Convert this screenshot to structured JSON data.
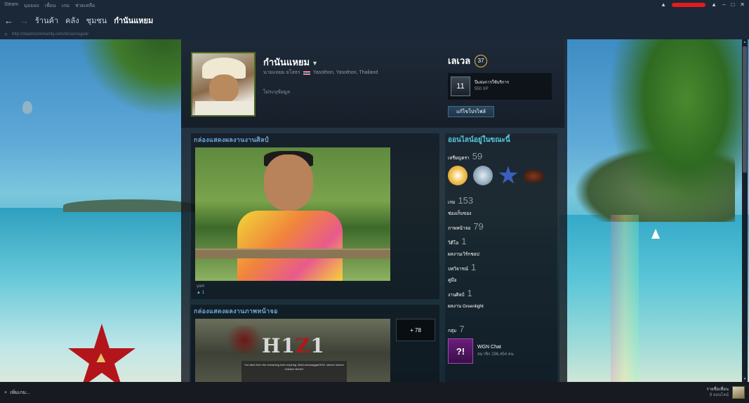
{
  "topmenu": [
    "Steam",
    "มุมมอง",
    "เพื่อน",
    "เกม",
    "ช่วยเหลือ"
  ],
  "nav": {
    "back": "←",
    "forward": "→",
    "tabs": [
      "ร้านค้า",
      "คลัง",
      "ชุมชน",
      "กำนันแหยม"
    ],
    "active_tab": "กำนันแหยม"
  },
  "url": "http://steamcommunity.com/id/sunnogod/",
  "profile": {
    "name": "กำนันแหยม",
    "real_name": "นายแหยม ยโสธร",
    "location": "Yasothon, Yasothon, Thailand",
    "summary": "ไม่ระบุข้อมูล",
    "level_label": "เลเวล",
    "level": "37",
    "badge_title": "ปีแห่งการใช้บริการ",
    "badge_xp": "550 XP",
    "badge_icon_text": "11",
    "edit_button": "แก้ไขโปรไฟล์"
  },
  "showcases": {
    "artwork_title": "กล่องแสดงผลงานงานศิลป์",
    "artwork_caption": "yam",
    "artwork_likes": "1",
    "screenshot_title": "กล่องแสดงผลงานภาพหน้าจอ",
    "screenshot_more": "+ 78",
    "screenshot_logo_a": "H1",
    "screenshot_logo_z": "Z",
    "screenshot_logo_b": "1",
    "screenshot_dialog": "You died from the remaining lives expiring. BobLee/swaggerHHH, winner winner chicken dinner!"
  },
  "sidebar": {
    "online_status": "ออนไลน์อยู่ในขณะนี้",
    "badges_label": "เหรียญตรา",
    "badges_count": "59",
    "games_label": "เกม",
    "games_count": "153",
    "inventory_label": "ช่องเก็บของ",
    "screenshots_label": "ภาพหน้าจอ",
    "screenshots_count": "79",
    "videos_label": "วิดีโอ",
    "videos_count": "1",
    "workshop_label": "ผลงานเวิร์กชอป",
    "reviews_label": "บทวิจารณ์",
    "reviews_count": "1",
    "guides_label": "คู่มือ",
    "artwork_label": "งานศิลป์",
    "artwork_count": "1",
    "greenlight_label": "ผลงาน Greenlight",
    "groups_label": "กลุ่ม",
    "groups_count": "7",
    "group_name": "WGN Chat",
    "group_members": "สมาชิก 296,454 คน",
    "group_icon_text": "?!"
  },
  "bottom": {
    "add_game": "เพิ่มเกม...",
    "friends_list": "รายชื่อเพื่อน",
    "friends_online": "9 ออนไลน์"
  },
  "colors": {
    "accent": "#57cbde",
    "level_ring": "#e2c03f",
    "showcase_title": "#6fa6d6",
    "topbar": "#1b2838"
  }
}
